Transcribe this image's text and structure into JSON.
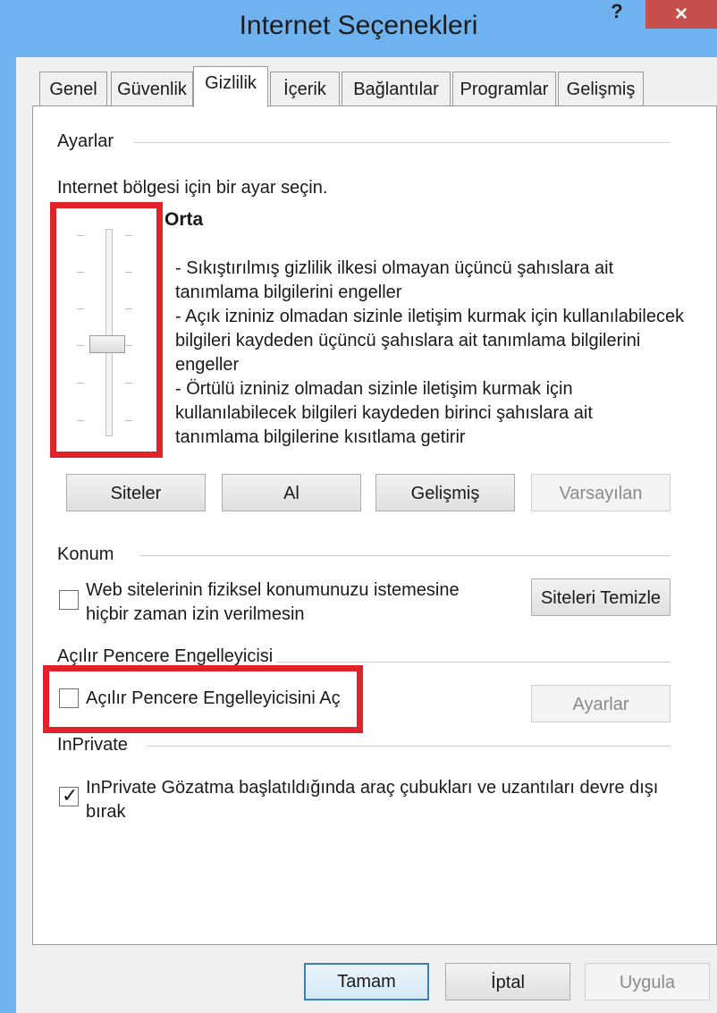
{
  "window": {
    "title": "Internet Seçenekleri",
    "help_label": "?",
    "close_label": "×"
  },
  "tabs": [
    {
      "label": "Genel"
    },
    {
      "label": "Güvenlik"
    },
    {
      "label": "Gizlilik"
    },
    {
      "label": "İçerik"
    },
    {
      "label": "Bağlantılar"
    },
    {
      "label": "Programlar"
    },
    {
      "label": "Gelişmiş"
    }
  ],
  "active_tab": "Gizlilik",
  "settings": {
    "group_label": "Ayarlar",
    "instruction": "Internet bölgesi için bir ayar seçin.",
    "level_name": "Orta",
    "slider_level": "Orta",
    "description_lines": [
      "- Sıkıştırılmış gizlilik ilkesi olmayan üçüncü şahıslara ait",
      "tanımlama bilgilerini engeller",
      "- Açık izniniz olmadan sizinle iletişim kurmak için kullanılabilecek",
      "bilgileri kaydeden üçüncü şahıslara ait tanımlama bilgilerini",
      "engeller",
      "- Örtülü izniniz olmadan sizinle iletişim kurmak için",
      "kullanılabilecek bilgileri kaydeden birinci şahıslara ait",
      "tanımlama bilgilerine kısıtlama getirir"
    ],
    "buttons": {
      "sites": "Siteler",
      "import": "Al",
      "advanced": "Gelişmiş",
      "default": "Varsayılan"
    }
  },
  "location": {
    "group_label": "Konum",
    "checkbox_lines": [
      "Web sitelerinin fiziksel konumunuzu istemesine",
      "hiçbir zaman izin verilmesin"
    ],
    "checked": false,
    "clear_sites": "Siteleri Temizle"
  },
  "popup": {
    "group_label": "Açılır Pencere Engelleyicisi",
    "checkbox_label": "Açılır Pencere Engelleyicisini Aç",
    "checked": false,
    "settings_button": "Ayarlar"
  },
  "inprivate": {
    "group_label": "InPrivate",
    "checkbox_lines": [
      "InPrivate Gözatma başlatıldığında araç çubukları ve uzantıları devre dışı",
      "bırak"
    ],
    "checked": true
  },
  "footer": {
    "ok": "Tamam",
    "cancel": "İptal",
    "apply": "Uygula"
  },
  "colors": {
    "title_bar": "#6fb2f0",
    "close_button": "#c7504c",
    "highlight": "#e2222a"
  }
}
